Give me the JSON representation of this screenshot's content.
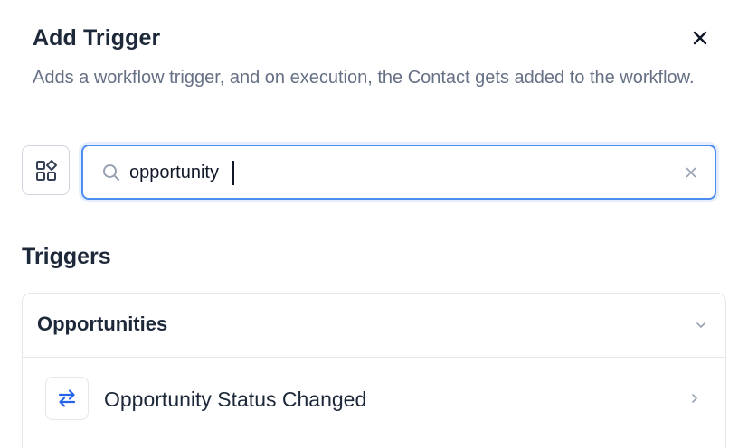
{
  "header": {
    "title": "Add Trigger",
    "description": "Adds a workflow trigger, and on execution, the Contact gets added to the workflow.",
    "close_icon": "close-icon"
  },
  "search": {
    "value": "opportunity",
    "placeholder": "",
    "icon": "search-icon",
    "clear_icon": "clear-icon",
    "view_toggle_icon": "grid-view-icon"
  },
  "triggers": {
    "section_title": "Triggers",
    "groups": [
      {
        "title": "Opportunities",
        "expanded": true,
        "items": [
          {
            "label": "Opportunity Status Changed",
            "icon": "arrows-swap-icon"
          }
        ]
      }
    ]
  },
  "colors": {
    "accent": "#4b8cf0",
    "icon_blue": "#2563eb",
    "text_primary": "#1d2939",
    "text_secondary": "#667085",
    "border": "#e4e7ec"
  }
}
